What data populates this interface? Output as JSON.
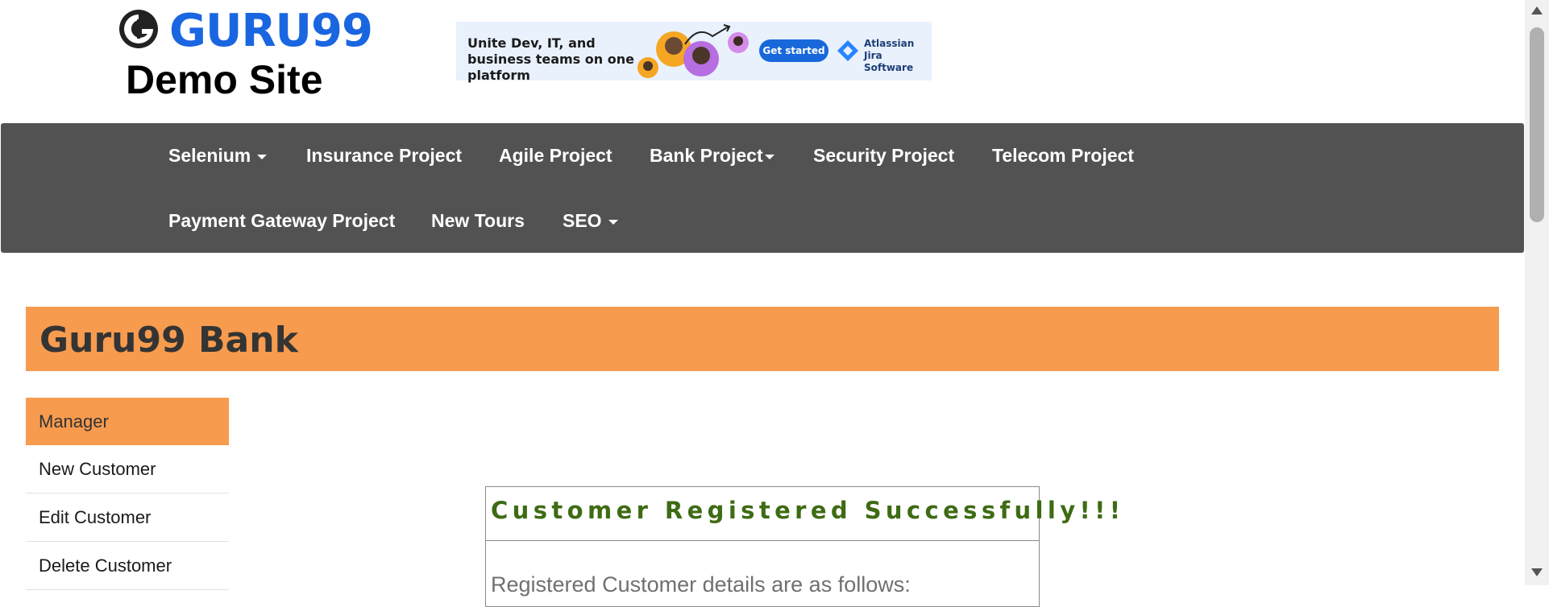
{
  "header": {
    "logo_text": "GURU99",
    "site_subtitle": "Demo Site"
  },
  "ad": {
    "text": "Unite Dev, IT, and business teams on one platform",
    "button_label": "Get started",
    "brand_line1": "Atlassian",
    "brand_line2": "Jira Software",
    "colors": {
      "background": "#e9f1fd",
      "button": "#1868db"
    }
  },
  "navbar": {
    "row1": [
      {
        "label": "Selenium",
        "dropdown": true
      },
      {
        "label": "Insurance Project",
        "dropdown": false
      },
      {
        "label": "Agile Project",
        "dropdown": false
      },
      {
        "label": "Bank Project",
        "dropdown": true
      },
      {
        "label": "Security Project",
        "dropdown": false
      },
      {
        "label": "Telecom Project",
        "dropdown": false
      }
    ],
    "row2": [
      {
        "label": "Payment Gateway Project",
        "dropdown": false
      },
      {
        "label": "New Tours",
        "dropdown": false
      },
      {
        "label": "SEO",
        "dropdown": true
      }
    ],
    "background": "#525252"
  },
  "bank": {
    "title": "Guru99 Bank",
    "accent": "#f79b4f"
  },
  "sidebar": {
    "items": [
      {
        "label": "Manager",
        "active": true
      },
      {
        "label": "New Customer",
        "active": false
      },
      {
        "label": "Edit Customer",
        "active": false
      },
      {
        "label": "Delete Customer",
        "active": false
      }
    ]
  },
  "result": {
    "title": "Customer Registered Successfully!!!",
    "subtitle": "Registered Customer details are as follows:",
    "title_color": "#3e6b13"
  }
}
